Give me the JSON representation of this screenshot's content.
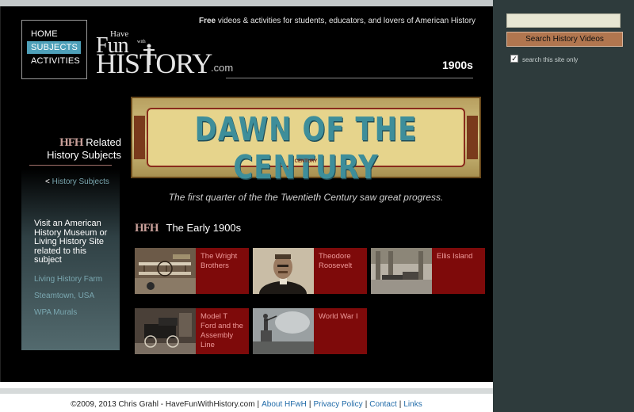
{
  "header": {
    "tagline_bold": "Free",
    "tagline_rest": " videos & activities for students, educators, and lovers of American History",
    "era": "1900s",
    "logo": {
      "have": "Have",
      "fun": "Fun",
      "with": "with",
      "history": "HISTORY",
      "dotcom": ".com"
    }
  },
  "nav": [
    {
      "label": "HOME",
      "active": false
    },
    {
      "label": "SUBJECTS",
      "active": true
    },
    {
      "label": "ACTIVITIES",
      "active": false
    }
  ],
  "search": {
    "value": "",
    "button_label": "Search History Videos",
    "site_only_label": "search this site only",
    "site_only_checked": true
  },
  "sidebar": {
    "hfh": "HFH",
    "title_line1": "Related",
    "title_line2": "History Subjects",
    "back_arrow": "<",
    "back_link": " History Subjects",
    "visit_text": "Visit an American History Museum or Living History Site related to this subject",
    "links": [
      "Living History Farm",
      "Steamtown, USA",
      "WPA Murals"
    ]
  },
  "banner": {
    "title": "DAWN OF THE CENTURY",
    "sub": "CENTURY"
  },
  "caption": "The first quarter of the the Twentieth Century saw great progress.",
  "section": {
    "hfh": "HFH",
    "title": "The Early 1900s"
  },
  "tiles": [
    {
      "label": "The Wright Brothers",
      "icon": "airplane-photo"
    },
    {
      "label": "Theodore Roosevelt",
      "icon": "portrait-photo"
    },
    {
      "label": "Ellis Island",
      "icon": "hall-photo"
    },
    {
      "label": "Model T Ford and the Assembly Line",
      "icon": "car-photo"
    },
    {
      "label": "World War I",
      "icon": "soldier-photo"
    }
  ],
  "footer": {
    "copyright": "©2009, 2013 Chris Grahl - HaveFunWithHistory.com",
    "links": [
      "About HFwH",
      "Privacy Policy",
      "Contact",
      "Links"
    ]
  }
}
